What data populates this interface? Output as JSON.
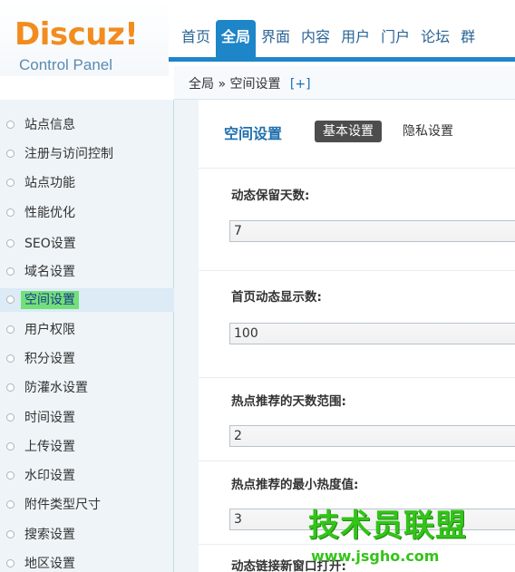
{
  "logo": {
    "brand": "Discuz!",
    "subtitle": "Control Panel"
  },
  "nav": {
    "tabs": [
      {
        "label": "首页",
        "active": false
      },
      {
        "label": "全局",
        "active": true
      },
      {
        "label": "界面",
        "active": false
      },
      {
        "label": "内容",
        "active": false
      },
      {
        "label": "用户",
        "active": false
      },
      {
        "label": "门户",
        "active": false
      },
      {
        "label": "论坛",
        "active": false
      },
      {
        "label": "群",
        "active": false
      }
    ]
  },
  "breadcrumb": {
    "path": "全局 » 空间设置",
    "add": "[+]"
  },
  "sidebar": {
    "items": [
      {
        "label": "站点信息"
      },
      {
        "label": "注册与访问控制"
      },
      {
        "label": "站点功能"
      },
      {
        "label": "性能优化"
      },
      {
        "label": "SEO设置"
      },
      {
        "label": "域名设置"
      },
      {
        "label": "空间设置",
        "active": true
      },
      {
        "label": "用户权限"
      },
      {
        "label": "积分设置"
      },
      {
        "label": "防灌水设置"
      },
      {
        "label": "时间设置"
      },
      {
        "label": "上传设置"
      },
      {
        "label": "水印设置"
      },
      {
        "label": "附件类型尺寸"
      },
      {
        "label": "搜索设置"
      },
      {
        "label": "地区设置"
      }
    ]
  },
  "main": {
    "title": "空间设置",
    "tabs": {
      "basic": "基本设置",
      "privacy": "隐私设置"
    },
    "fields": [
      {
        "label": "动态保留天数:",
        "value": "7"
      },
      {
        "label": "首页动态显示数:",
        "value": "100"
      },
      {
        "label": "热点推荐的天数范围:",
        "value": "2"
      },
      {
        "label": "热点推荐的最小热度值:",
        "value": "3"
      },
      {
        "label": "动态链接新窗口打开:"
      }
    ]
  },
  "watermark": {
    "title": "技术员联盟",
    "url": "www.jsgho.com"
  },
  "colors": {
    "accent": "#1e85c8",
    "highlight": "#72e07a",
    "logo": "#f28c1e",
    "watermark": "#33c41a"
  }
}
